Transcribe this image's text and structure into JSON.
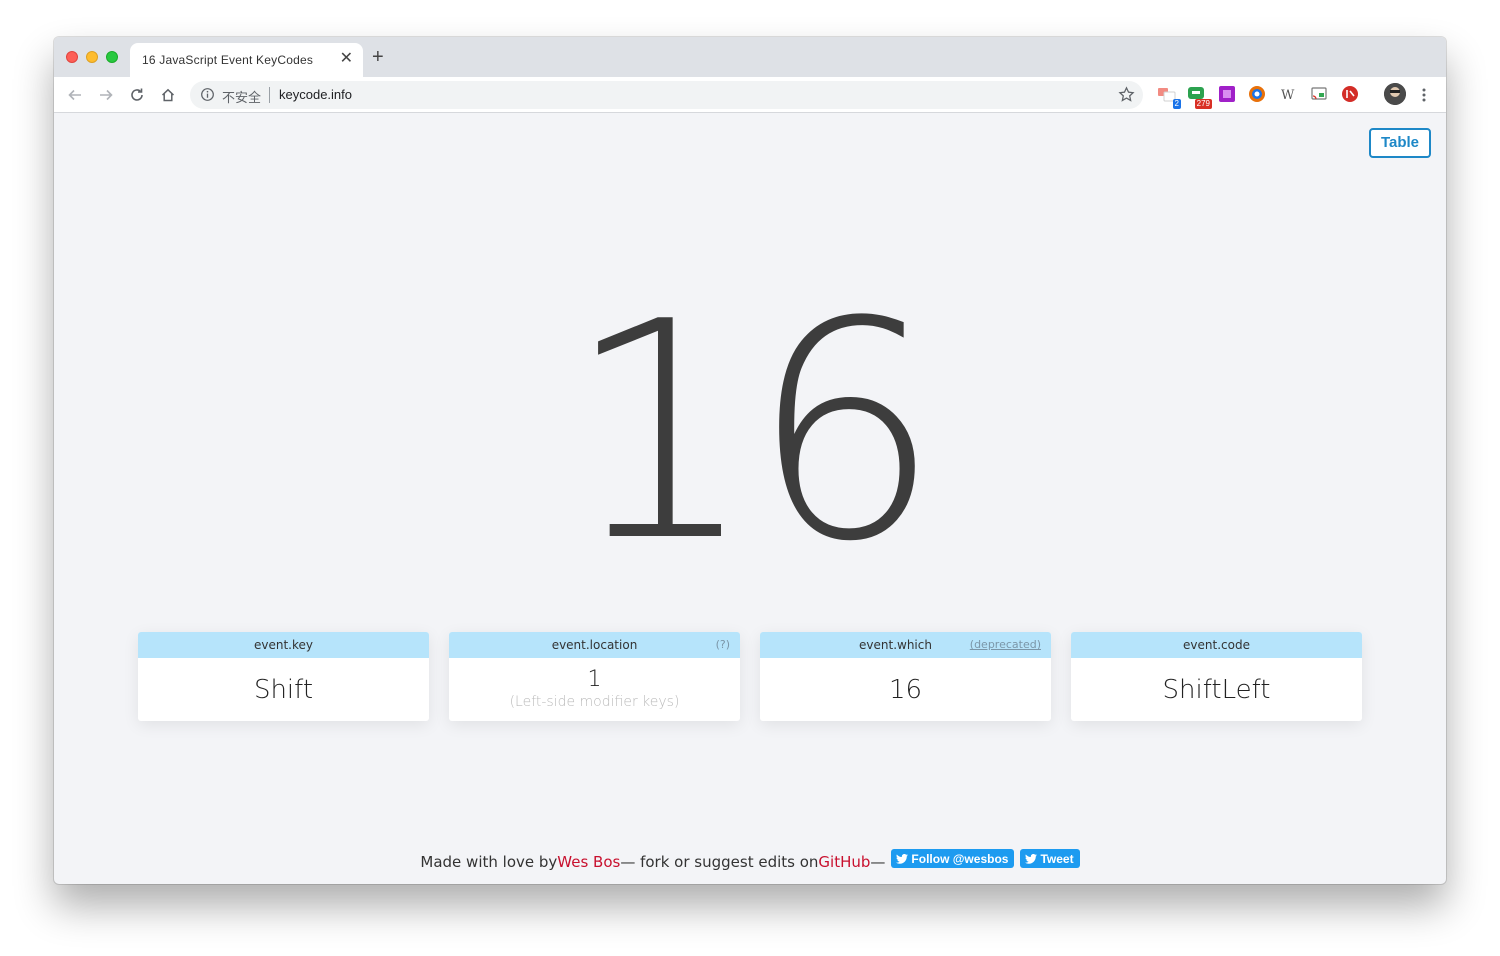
{
  "browser": {
    "tab_title": "16  JavaScript Event KeyCodes",
    "tab_close": "✕",
    "new_tab": "+",
    "insecure_label": "不安全",
    "url": "keycode.info",
    "extensions": [
      {
        "name": "translate-extension",
        "badge": "2",
        "badge_color": "#1a73e8"
      },
      {
        "name": "chat-extension",
        "badge": "279",
        "badge_color": "#d93025"
      },
      {
        "name": "onenote-extension",
        "badge": "",
        "badge_color": ""
      },
      {
        "name": "color-picker-extension",
        "badge": "",
        "badge_color": ""
      },
      {
        "name": "wikipedia-extension",
        "badge": "",
        "badge_color": ""
      },
      {
        "name": "cast-extension",
        "badge": "",
        "badge_color": ""
      },
      {
        "name": "lastpass-extension",
        "badge": "",
        "badge_color": ""
      }
    ]
  },
  "page": {
    "table_button": "Table",
    "key_code": "16",
    "cards": [
      {
        "label": "event.key",
        "value": "Shift",
        "sub": "",
        "link": ""
      },
      {
        "label": "event.location",
        "value": "1",
        "sub": "(Left-side modifier keys)",
        "link": "(?)"
      },
      {
        "label": "event.which",
        "value": "16",
        "sub": "",
        "link": "(deprecated)"
      },
      {
        "label": "event.code",
        "value": "ShiftLeft",
        "sub": "",
        "link": ""
      }
    ],
    "footer": {
      "prefix": "Made with love by ",
      "author": "Wes Bos",
      "middle": " — fork or suggest edits on ",
      "github": "GitHub",
      "suffix": " — ",
      "follow_button": "Follow @wesbos",
      "tweet_button": "Tweet"
    }
  },
  "colors": {
    "accent": "#1e88c7",
    "card_header": "#b6e4fb",
    "link_red": "#c8102e",
    "twitter": "#1d9bf0"
  }
}
